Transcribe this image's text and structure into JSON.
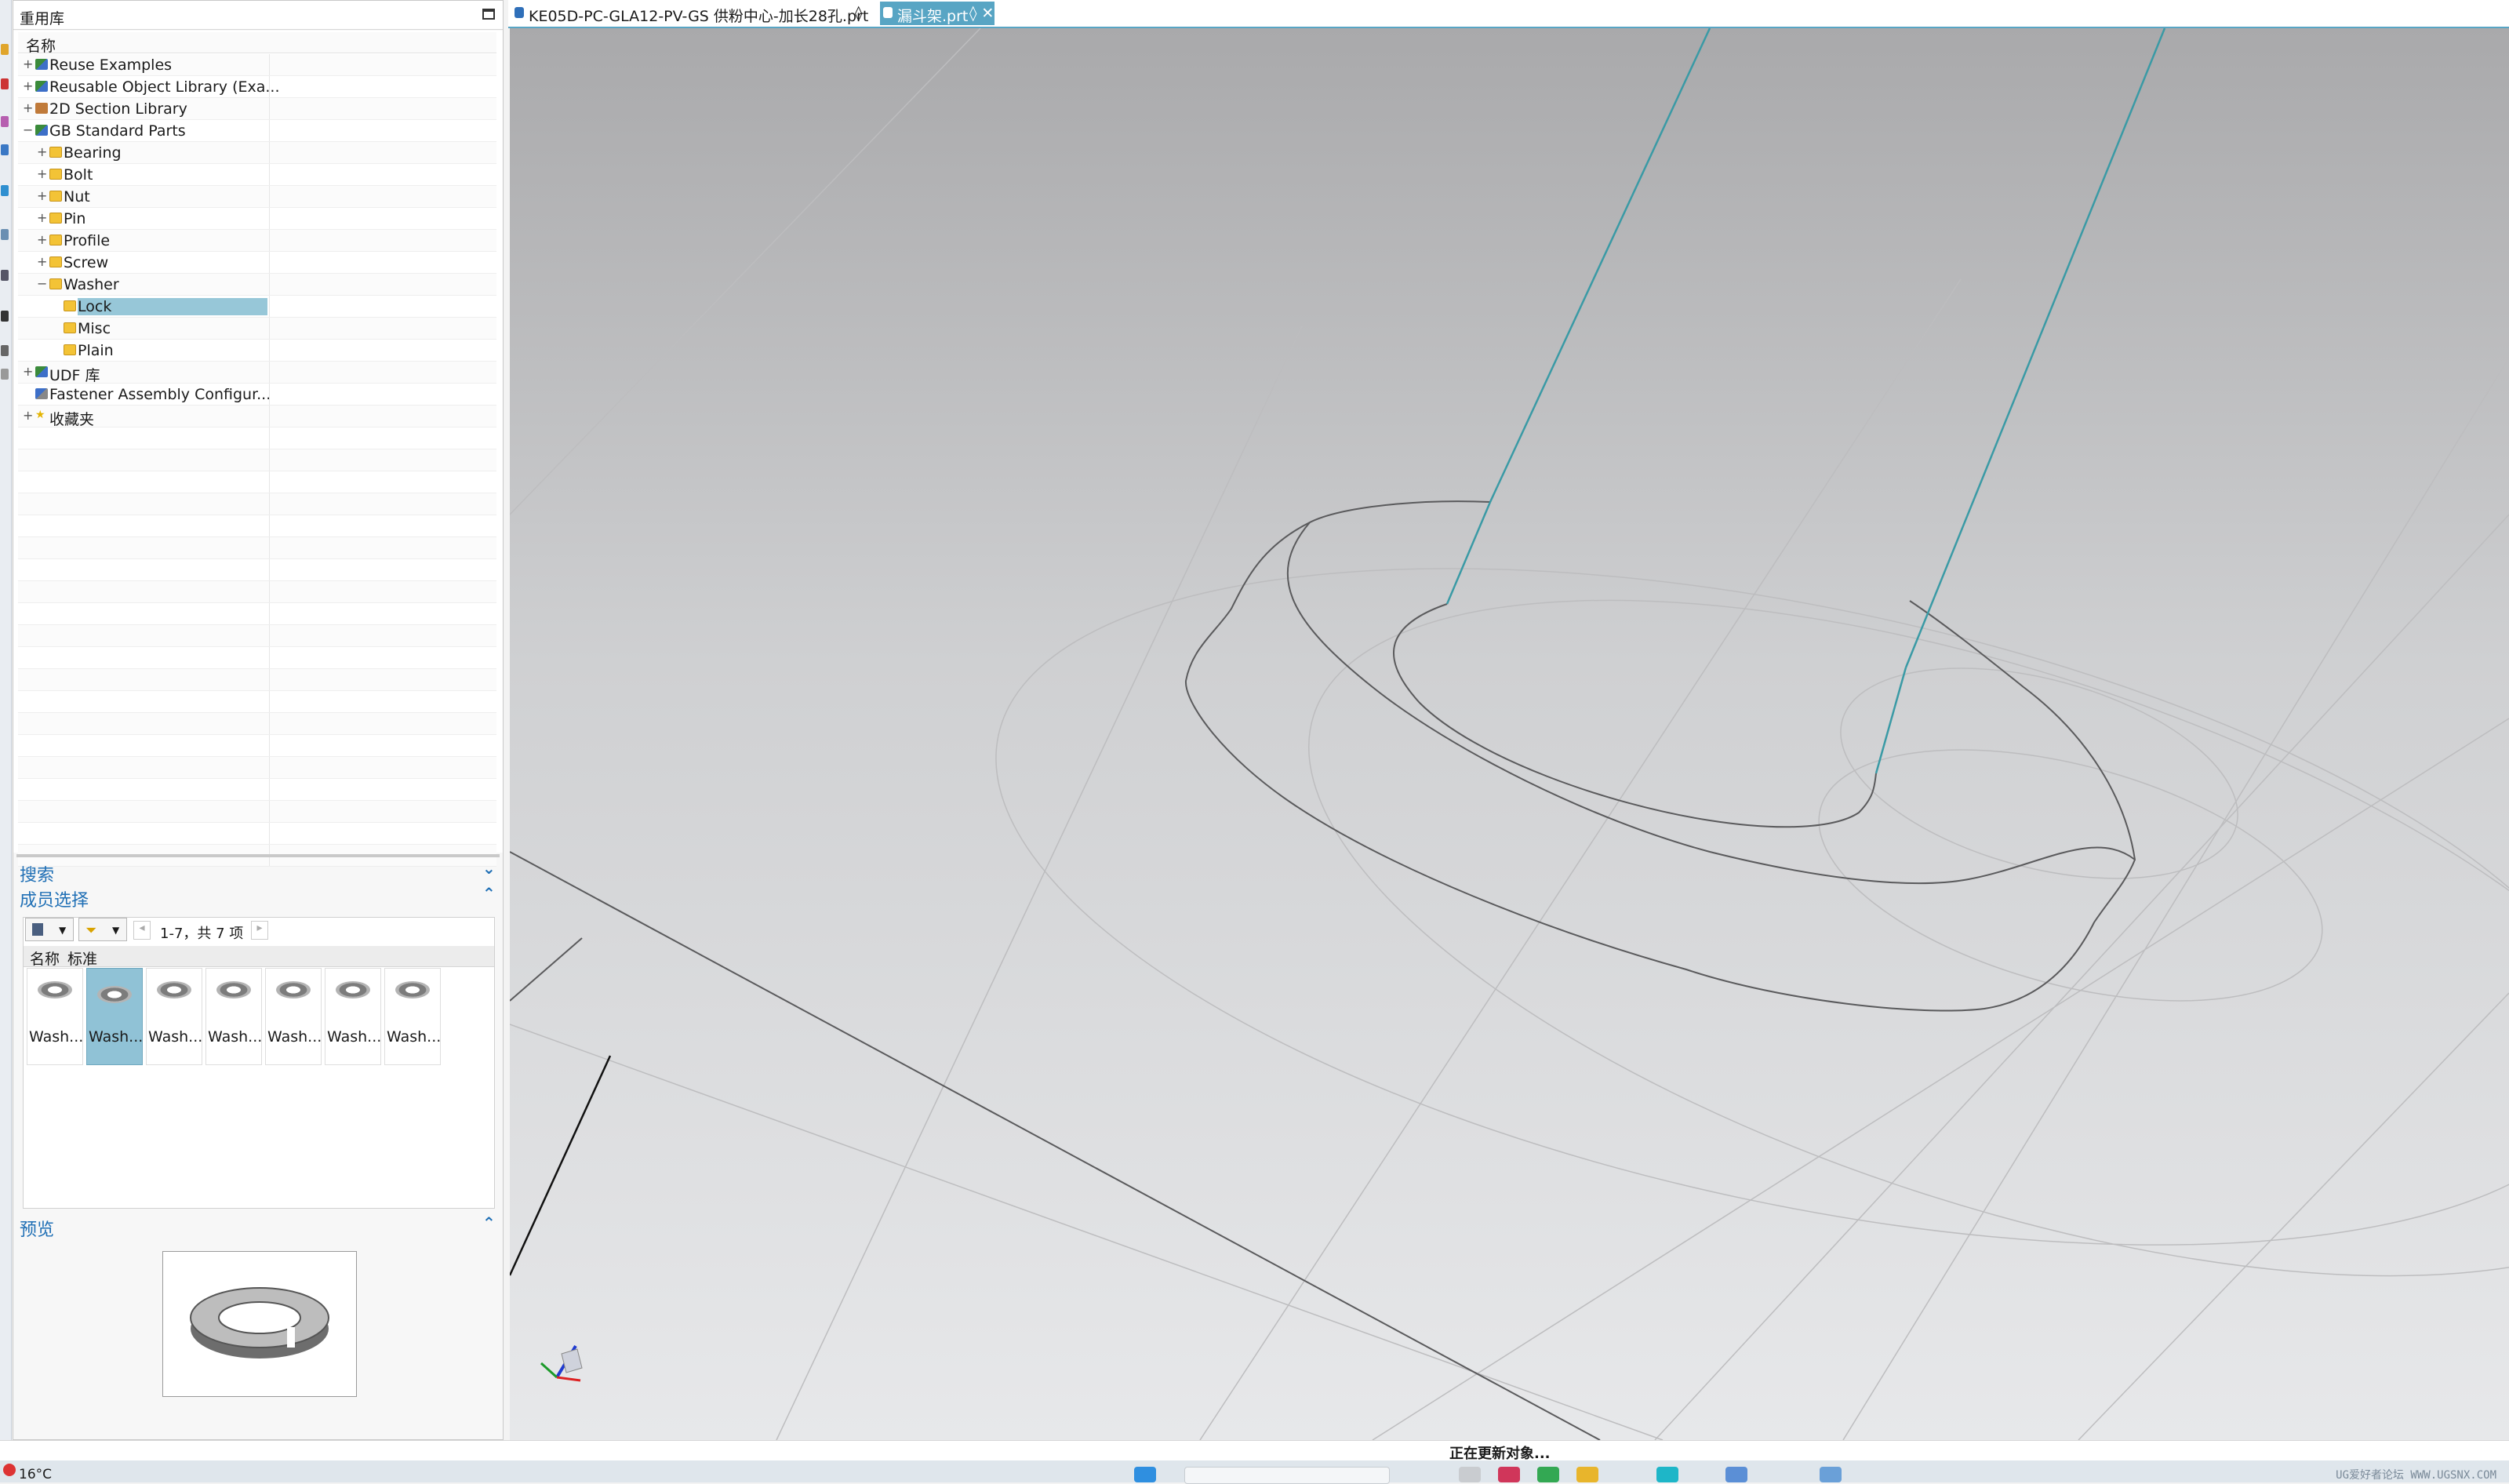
{
  "panel": {
    "title": "重用库",
    "tree_header": "名称",
    "tree": [
      {
        "label": "Reuse Examples",
        "icon": "library-icon",
        "expander": "+",
        "level": 0
      },
      {
        "label": "Reusable Object Library (Exa...",
        "icon": "library-icon",
        "expander": "+",
        "level": 0
      },
      {
        "label": "2D Section Library",
        "icon": "section-library-icon",
        "expander": "+",
        "level": 0
      },
      {
        "label": "GB Standard Parts",
        "icon": "library-icon",
        "expander": "−",
        "level": 0
      },
      {
        "label": "Bearing",
        "icon": "folder-icon",
        "expander": "+",
        "level": 1
      },
      {
        "label": "Bolt",
        "icon": "folder-icon",
        "expander": "+",
        "level": 1
      },
      {
        "label": "Nut",
        "icon": "folder-icon",
        "expander": "+",
        "level": 1
      },
      {
        "label": "Pin",
        "icon": "folder-icon",
        "expander": "+",
        "level": 1
      },
      {
        "label": "Profile",
        "icon": "folder-icon",
        "expander": "+",
        "level": 1
      },
      {
        "label": "Screw",
        "icon": "folder-icon",
        "expander": "+",
        "level": 1
      },
      {
        "label": "Washer",
        "icon": "folder-icon",
        "expander": "−",
        "level": 1
      },
      {
        "label": "Lock",
        "icon": "folder-icon",
        "expander": "",
        "level": 2,
        "selected": true
      },
      {
        "label": "Misc",
        "icon": "folder-icon",
        "expander": "",
        "level": 2
      },
      {
        "label": "Plain",
        "icon": "folder-icon",
        "expander": "",
        "level": 2
      },
      {
        "label": "UDF 库",
        "icon": "library-icon",
        "expander": "+",
        "level": 0
      },
      {
        "label": "Fastener Assembly Configur...",
        "icon": "fastener-icon",
        "expander": "",
        "level": 0
      },
      {
        "label": "收藏夹",
        "icon": "star-icon",
        "expander": "+",
        "level": 0
      }
    ],
    "search_section": "搜索",
    "member_section": "成员选择",
    "pager_text": "1-7，共 7 项",
    "columns": [
      "名称",
      "标准"
    ],
    "members": [
      "Wash...",
      "Wash...",
      "Wash...",
      "Wash...",
      "Wash...",
      "Wash...",
      "Wash..."
    ],
    "preview_section": "预览"
  },
  "tabs": [
    {
      "label": "KE05D-PC-GLA12-PV-GS 供粉中心-加长28孔.prt",
      "suffix": "◊",
      "active": false
    },
    {
      "label": "漏斗架.prt",
      "suffix": "◊ ✕",
      "active": true
    }
  ],
  "status": {
    "text": "正在更新对象..."
  },
  "taskbar": {
    "temperature": "16°C",
    "watermark": "UG爱好者论坛 WWW.UGSNX.COM"
  },
  "colors": {
    "accent": "#58a5c4",
    "selection": "#97c7d8",
    "section_title": "#1f6fb5",
    "edge_highlight": "#3a9aa5"
  }
}
